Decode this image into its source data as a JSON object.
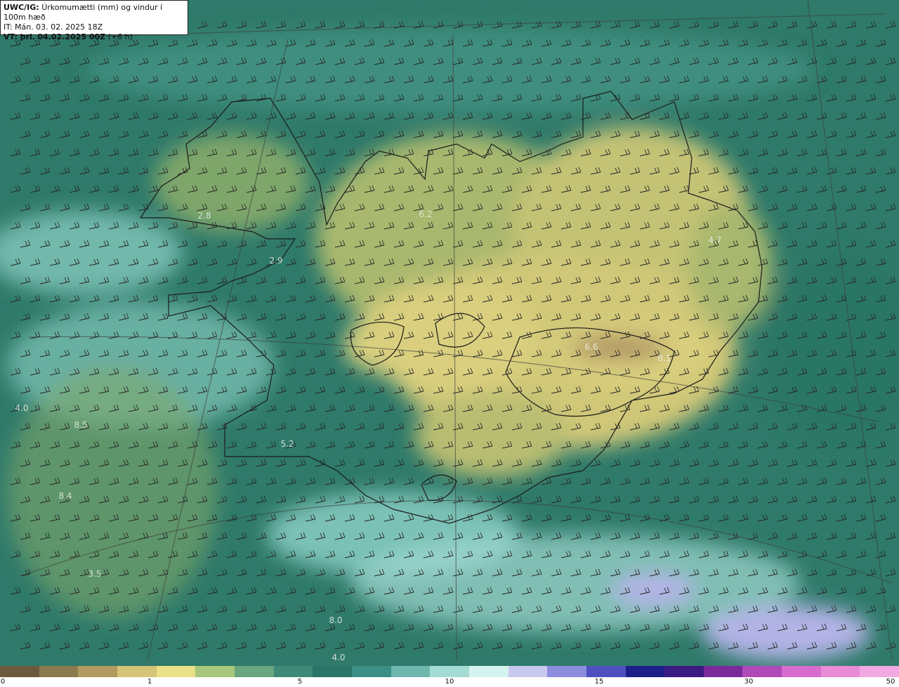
{
  "header": {
    "model": "UWC/IG:",
    "title": "Úrkomumætti (mm) og vindur í 100m hæð",
    "init_time": "IT: Mán. 03. 02. 2025 18Z",
    "valid_prefix": "VT: þri.",
    "valid_time": "04.02.2025 00Z",
    "lead": "(+6 h)"
  },
  "value_labels": [
    "2.8",
    "6.2",
    "4.7",
    "2.9",
    "4.0",
    "8.5",
    "5.2",
    "8.4",
    "3.5",
    "8.0",
    "4.0",
    "6.6",
    "8.1"
  ],
  "colorbar": {
    "ticks": [
      "0",
      "1",
      "5",
      "10",
      "15",
      "30",
      "50"
    ],
    "colors": [
      "#6b5a3e",
      "#8a7a4e",
      "#b09a60",
      "#d6c478",
      "#e9e088",
      "#a8c77a",
      "#6aa77e",
      "#3f8a77",
      "#2a7468",
      "#3c8f85",
      "#6fb7ae",
      "#a4dcd4",
      "#d6f4ef",
      "#c9c9ef",
      "#8d8de0",
      "#4f4fc0",
      "#1f1f8a",
      "#3b1a84",
      "#7a2a9a",
      "#b04ab8",
      "#d86ccc",
      "#e98bd6",
      "#f2a8e0"
    ]
  },
  "colors": {
    "sea_dark": "#2a7665",
    "sea_mid": "#3f8e7f",
    "sea_light": "#8fd3c8",
    "land_green": "#7fa66a",
    "land_yellow": "#d9cf7e",
    "land_peak": "#b39a66",
    "violet": "#b3b3e6",
    "coast": "#1a1a1a",
    "barb": "#2a2a2a"
  }
}
